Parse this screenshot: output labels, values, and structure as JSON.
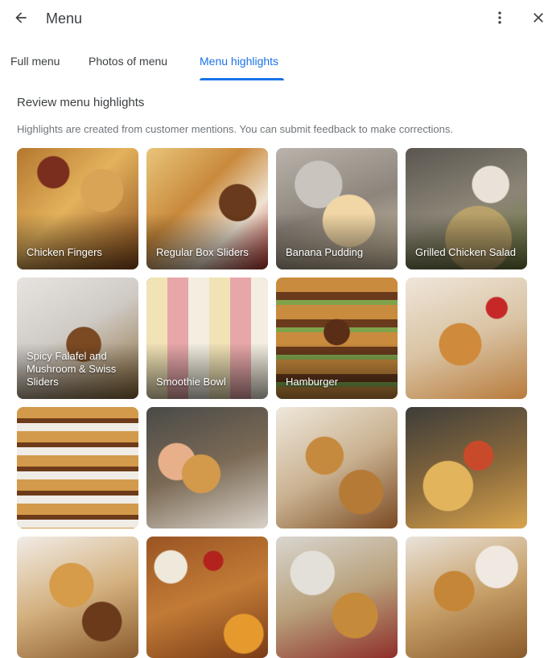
{
  "header": {
    "title": "Menu",
    "back_icon": "arrow-left-icon",
    "more_icon": "more-vert-icon",
    "close_icon": "close-icon"
  },
  "tabs": [
    {
      "label": "Full menu",
      "active": false
    },
    {
      "label": "Photos of menu",
      "active": false
    },
    {
      "label": "Menu highlights",
      "active": true
    }
  ],
  "highlights": {
    "title": "Review menu highlights",
    "description": "Highlights are created from customer mentions. You can submit feedback to make corrections.",
    "items": [
      {
        "label": "Chicken Fingers"
      },
      {
        "label": "Regular Box Sliders"
      },
      {
        "label": "Banana Pudding"
      },
      {
        "label": "Grilled Chicken Salad"
      },
      {
        "label": "Spicy Falafel and Mushroom & Swiss Sliders"
      },
      {
        "label": "Smoothie Bowl"
      },
      {
        "label": "Hamburger"
      },
      {
        "label": ""
      },
      {
        "label": ""
      },
      {
        "label": ""
      },
      {
        "label": ""
      },
      {
        "label": ""
      },
      {
        "label": ""
      },
      {
        "label": ""
      },
      {
        "label": ""
      },
      {
        "label": ""
      }
    ]
  },
  "colors": {
    "accent": "#1a73e8",
    "text": "#3c4043",
    "muted": "#70757a"
  }
}
